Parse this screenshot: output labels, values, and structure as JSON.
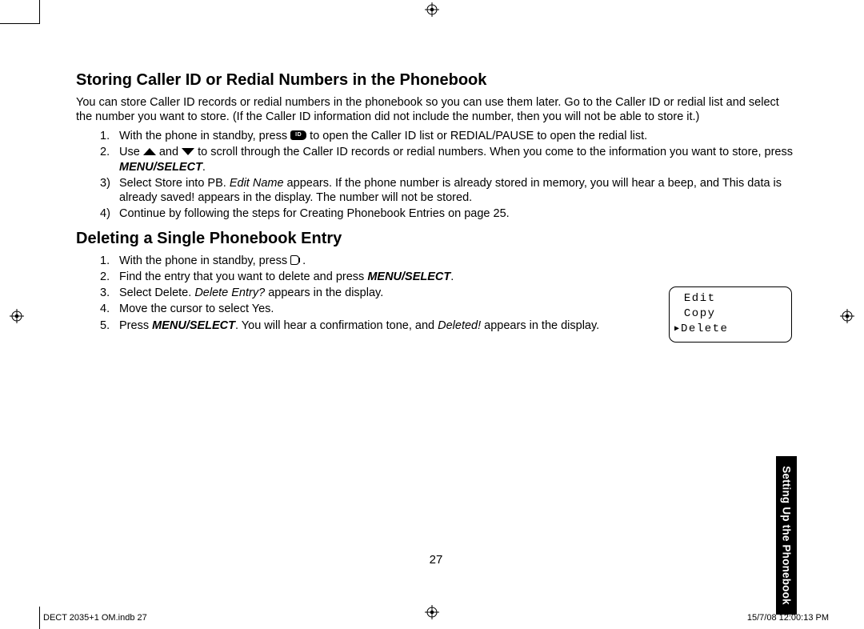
{
  "section1": {
    "heading": "Storing Caller ID or Redial Numbers in the Phonebook",
    "intro": "You can store Caller ID records or redial numbers in the phonebook so you can use them later. Go to the Caller ID or redial list and select the number you want to store. (If the Caller ID information did not include the number, then you will not be able to store it.)",
    "steps": {
      "s1a": "With the phone in standby, press ",
      "s1b": " to open the Caller ID list or REDIAL/PAUSE to open the redial list.",
      "s2a": "Use ",
      "s2b": " and ",
      "s2c": " to scroll through the Caller ID records or redial numbers. When you come to the information you want to store, press ",
      "s2d": "MENU/SELECT",
      "s2e": ".",
      "s3a": "Select Store into PB. ",
      "s3b": "Edit Name",
      "s3c": " appears. If the phone number is already stored in memory, you will hear a beep, and This data is already saved! appears in the display. The number will not be stored.",
      "s4": "Continue by following the steps for Creating Phonebook Entries on page 25."
    }
  },
  "section2": {
    "heading": "Deleting a Single Phonebook Entry",
    "steps": {
      "s1a": "With the phone in standby, press ",
      "s1b": " .",
      "s2a": "Find the entry that you want to delete and press ",
      "s2b": "MENU/SELECT",
      "s2c": ".",
      "s3a": "Select Delete. ",
      "s3b": "Delete Entry?",
      "s3c": " appears in the display.",
      "s4": "Move the cursor to select Yes.",
      "s5a": "Press ",
      "s5b": "MENU/SELECT",
      "s5c": ". You will hear a confirmation tone, and ",
      "s5d": "Deleted!",
      "s5e": " appears in the display."
    }
  },
  "lcd": {
    "row1": " Edit",
    "row2": " Copy",
    "row3": "Delete"
  },
  "sidetab": "Setting Up the Phonebook",
  "pagenum": "27",
  "footer": {
    "left": "DECT 2035+1 OM.indb   27",
    "right": "15/7/08   12:00:13 PM"
  },
  "icons": {
    "cid": "ID"
  }
}
